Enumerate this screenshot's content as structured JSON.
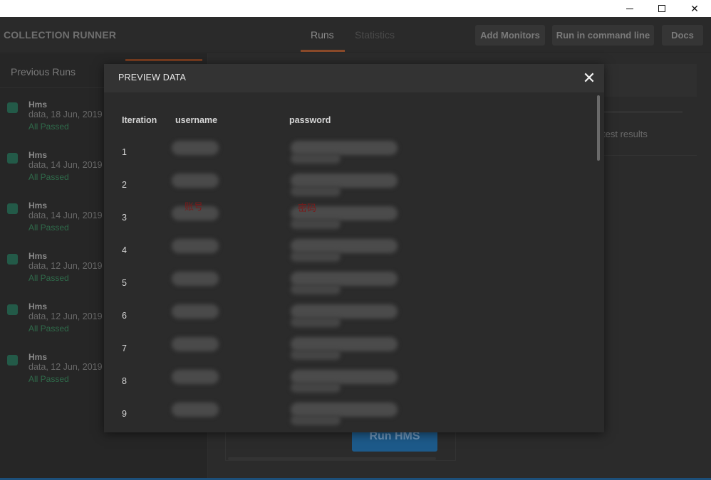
{
  "window": {
    "minimize_icon": "minimize-icon",
    "maximize_icon": "maximize-icon",
    "close_icon": "close-icon"
  },
  "header": {
    "title": "COLLECTION RUNNER",
    "tabs": [
      {
        "label": "Runs",
        "active": true
      },
      {
        "label": "Statistics",
        "active": false
      }
    ],
    "buttons": {
      "add_monitors": "Add Monitors",
      "run_cli": "Run in command line",
      "docs": "Docs"
    }
  },
  "sidebar": {
    "title": "Previous Runs",
    "runs": [
      {
        "name": "Hms",
        "date": "data, 18 Jun, 2019",
        "status": "All Passed"
      },
      {
        "name": "Hms",
        "date": "data, 14 Jun, 2019",
        "status": "All Passed"
      },
      {
        "name": "Hms",
        "date": "data, 14 Jun, 2019",
        "status": "All Passed"
      },
      {
        "name": "Hms",
        "date": "data, 12 Jun, 2019",
        "status": "All Passed"
      },
      {
        "name": "Hms",
        "date": "data, 12 Jun, 2019",
        "status": "All Passed"
      },
      {
        "name": "Hms",
        "date": "data, 12 Jun, 2019",
        "status": "All Passed"
      }
    ]
  },
  "main": {
    "test_results_label": "test results",
    "run_button": "Run HMS"
  },
  "modal": {
    "title": "PREVIEW DATA",
    "close_icon": "close-icon",
    "columns": {
      "iteration": "Iteration",
      "username": "username",
      "password": "password"
    },
    "rows": [
      "1",
      "2",
      "3",
      "4",
      "5",
      "6",
      "7",
      "8",
      "9"
    ],
    "annotations": {
      "username_note": "账号",
      "password_note": "密码"
    }
  },
  "colors": {
    "accent": "#8a4a2a",
    "passed": "#2f6a4a",
    "run_button": "#1d5a8a",
    "note": "#7a1a1a"
  }
}
